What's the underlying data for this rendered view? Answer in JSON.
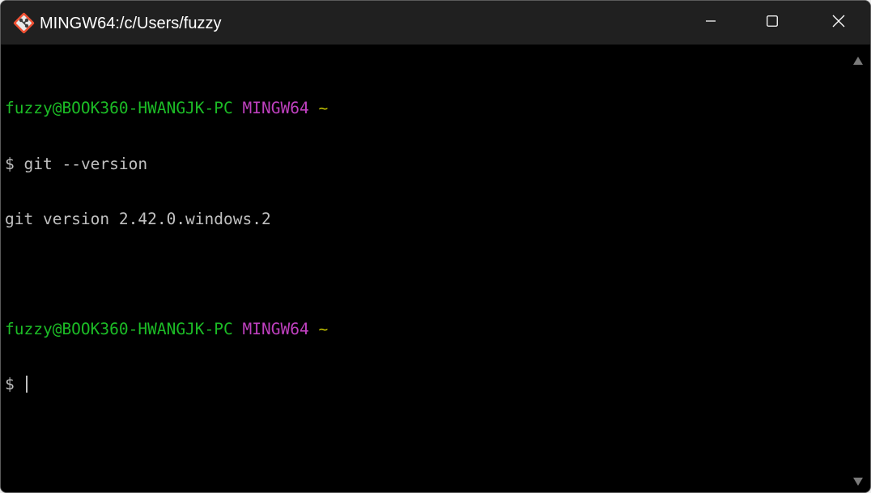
{
  "window": {
    "title": "MINGW64:/c/Users/fuzzy",
    "icon": "git-bash-icon",
    "controls": {
      "minimize": "minimize-icon",
      "maximize": "maximize-icon",
      "close": "close-icon"
    }
  },
  "terminal": {
    "lines": [
      {
        "user": "fuzzy@BOOK360-HWANGJK-PC",
        "shell": "MINGW64",
        "cwd": "~"
      },
      {
        "prompt": "$",
        "command": "git --version"
      },
      {
        "output": "git version 2.42.0.windows.2"
      },
      {
        "blank": ""
      },
      {
        "user": "fuzzy@BOOK360-HWANGJK-PC",
        "shell": "MINGW64",
        "cwd": "~"
      },
      {
        "prompt": "$",
        "command": ""
      }
    ]
  },
  "colors": {
    "background": "#000000",
    "titlebar": "#202020",
    "user": "#1cbc26",
    "shell": "#bf40bf",
    "cwd": "#bfbf00",
    "text": "#c0c0c0"
  }
}
